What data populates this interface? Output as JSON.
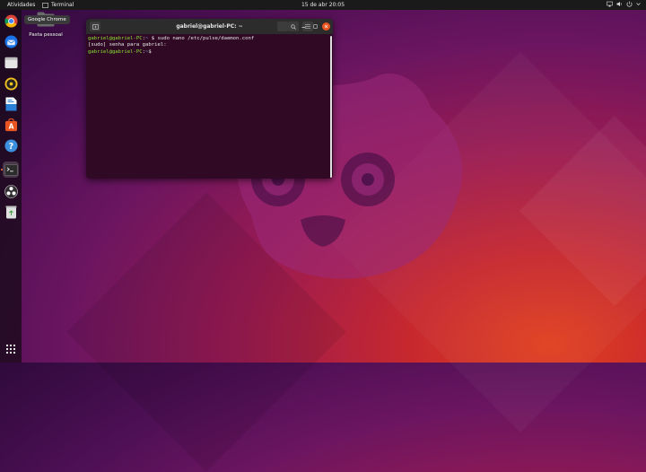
{
  "topbar": {
    "activities": "Atividades",
    "app_name": "Terminal",
    "clock": "15 de abr  20:05"
  },
  "dock": {
    "items": [
      {
        "name": "Google Chrome",
        "icon": "chrome-icon"
      },
      {
        "name": "Thunderbird",
        "icon": "thunderbird-icon"
      },
      {
        "name": "Files",
        "icon": "files-icon"
      },
      {
        "name": "Rhythmbox",
        "icon": "rhythmbox-icon"
      },
      {
        "name": "LibreOffice Writer",
        "icon": "writer-icon"
      },
      {
        "name": "Ubuntu Software",
        "icon": "software-icon"
      },
      {
        "name": "Help",
        "icon": "help-icon"
      },
      {
        "name": "Terminal",
        "icon": "terminal-icon"
      },
      {
        "name": "OBS Studio",
        "icon": "obs-icon"
      },
      {
        "name": "Trash",
        "icon": "trash-icon"
      }
    ],
    "tooltip": "Google Chrome"
  },
  "desktop": {
    "home_folder_label": "Pasta pessoal"
  },
  "terminal": {
    "title": "gabriel@gabriel-PC: ~",
    "lines": [
      {
        "prompt": "gabriel@gabriel-PC",
        "path": "~",
        "command": "$ sudo nano /etc/pulse/daemon.conf"
      },
      {
        "text": "[sudo] senha para gabriel:"
      },
      {
        "prompt": "gabriel@gabriel-PC",
        "path": "~",
        "command": "$"
      }
    ]
  },
  "colors": {
    "terminal_bg": "#300a24",
    "prompt_green": "#8ae234",
    "path_blue": "#729fcf",
    "accent_orange": "#e95420"
  }
}
